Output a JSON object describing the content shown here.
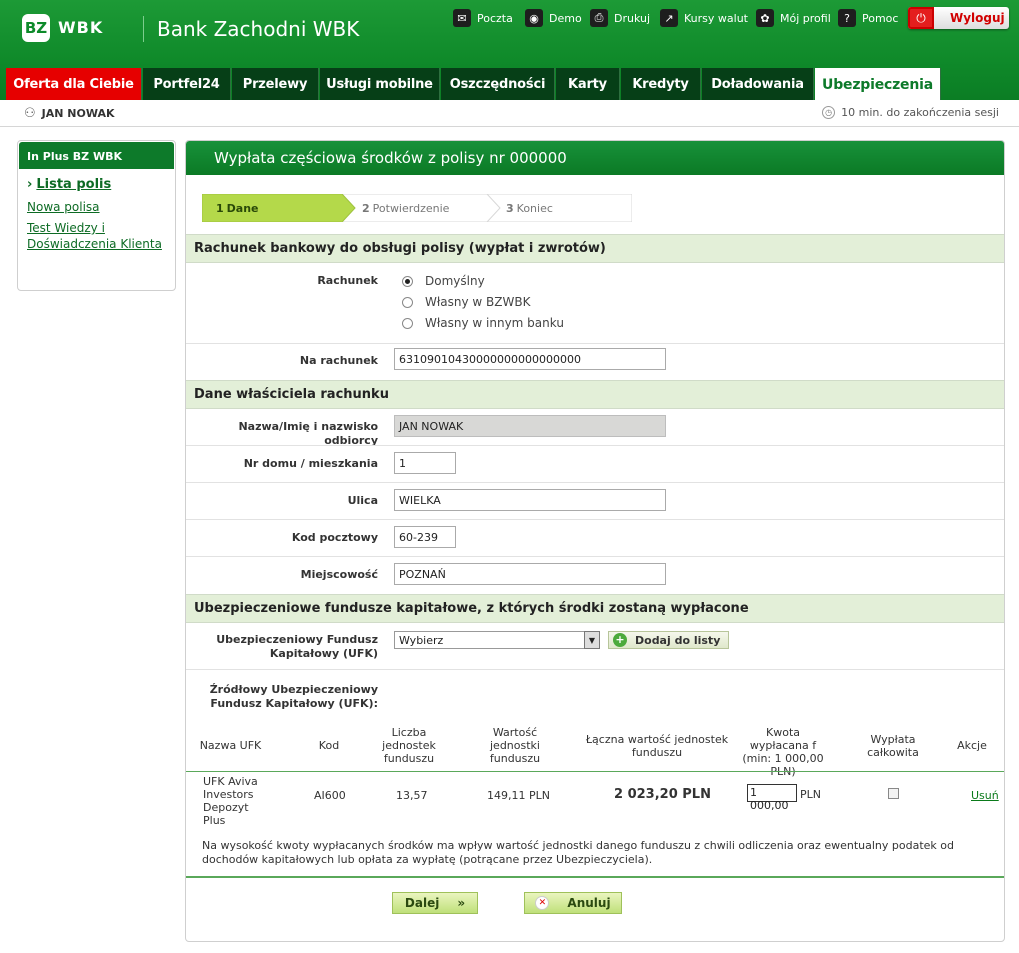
{
  "brand": {
    "logo_mark": "BZ",
    "logo_text": "WBK",
    "name": "Bank Zachodni WBK"
  },
  "toplinks": [
    {
      "label": "Poczta",
      "icon": "mail-icon"
    },
    {
      "label": "Demo",
      "icon": "demo-icon"
    },
    {
      "label": "Drukuj",
      "icon": "print-icon"
    },
    {
      "label": "Kursy walut",
      "icon": "chart-icon"
    },
    {
      "label": "Mój profil",
      "icon": "profile-icon"
    },
    {
      "label": "Pomoc",
      "icon": "help-icon"
    }
  ],
  "logout": {
    "label": "Wyloguj"
  },
  "tabs": [
    "Oferta dla Ciebie",
    "Portfel24",
    "Przelewy",
    "Usługi mobilne",
    "Oszczędności",
    "Karty",
    "Kredyty",
    "Doładowania",
    "Ubezpieczenia"
  ],
  "user": {
    "name": "JAN NOWAK",
    "session": "10 min. do zakończenia sesji"
  },
  "sidebar": {
    "title": "In Plus BZ WBK",
    "items": [
      "Lista polis",
      "Nowa polisa",
      "Test Wiedzy i Doświadczenia Klienta"
    ]
  },
  "main": {
    "title": "Wypłata częściowa środków z polisy nr 000000"
  },
  "steps": [
    {
      "num": "1",
      "label": "Dane"
    },
    {
      "num": "2",
      "label": "Potwierdzenie"
    },
    {
      "num": "3",
      "label": "Koniec"
    }
  ],
  "section1": {
    "title": "Rachunek bankowy do obsługi polisy (wypłat i zwrotów)",
    "rachunek_label": "Rachunek",
    "options": [
      "Domyślny",
      "Własny w BZWBK",
      "Własny w innym banku"
    ],
    "account_label": "Na rachunek",
    "account_value": "63109010430000000000000000"
  },
  "section2": {
    "title": "Dane właściciela rachunku",
    "name_label": "Nazwa/Imię i nazwisko odbiorcy",
    "name_value": "JAN NOWAK",
    "house_label": "Nr domu / mieszkania",
    "house_value": "1",
    "street_label": "Ulica",
    "street_value": "WIELKA",
    "zip_label": "Kod pocztowy",
    "zip_value": "60-239",
    "city_label": "Miejscowość",
    "city_value": "POZNAŃ"
  },
  "section3": {
    "title": "Ubezpieczeniowe fundusze kapitałowe, z których środki zostaną wypłacone",
    "ufk_label": "Ubezpieczeniowy Fundusz Kapitałowy (UFK)",
    "ufk_select": "Wybierz",
    "add_button": "Dodaj do listy",
    "source_label": "Źródłowy Ubezpieczeniowy Fundusz Kapitałowy (UFK):"
  },
  "table": {
    "headers": [
      "Nazwa UFK",
      "Kod",
      "Liczba jednostek funduszu",
      "Wartość jednostki funduszu",
      "Łączna wartość jednostek funduszu",
      "Kwota wypłacana f (min: 1 000,00 PLN)",
      "Wypłata całkowita",
      "Akcje"
    ],
    "row": {
      "name": "UFK Aviva Investors Depozyt Plus",
      "code": "AI600",
      "units": "13,57",
      "unit_value": "149,11 PLN",
      "total": "2 023,20 PLN",
      "amount": "1 000,00",
      "currency": "PLN",
      "action": "Usuń"
    }
  },
  "note": "Na wysokość kwoty wypłacanych środków ma wpływ wartość jednostki danego funduszu z chwili odliczenia oraz ewentualny podatek od dochodów kapitałowych lub opłata za wypłatę (potrącane przez Ubezpieczyciela).",
  "buttons": {
    "next": "Dalej",
    "cancel": "Anuluj"
  }
}
